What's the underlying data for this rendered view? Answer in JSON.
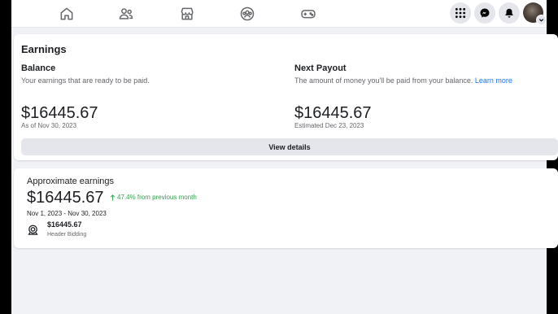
{
  "nav": {
    "icons": [
      "home-icon",
      "friends-icon",
      "marketplace-icon",
      "groups-icon",
      "gaming-icon"
    ],
    "actions": [
      "menu-grid-icon",
      "messenger-icon",
      "notifications-icon"
    ],
    "accent": "#1877f2"
  },
  "earnings": {
    "title": "Earnings",
    "balance": {
      "heading": "Balance",
      "description": "Your earnings that are ready to be paid.",
      "amount": "$16445.67",
      "date": "As of Nov 30, 2023"
    },
    "payout": {
      "heading": "Next Payout",
      "description": "The amount of money you'll be paid from your balance.",
      "learn_more": "Learn more",
      "amount": "$16445.67",
      "date": "Estimated Dec 23, 2023"
    },
    "view_details_label": "View details"
  },
  "approximate": {
    "title": "Approximate earnings",
    "amount": "$16445.67",
    "growth": "47.4% from previous month",
    "growth_color": "#31a24c",
    "date_range": "Nov 1, 2023 - Nov 30, 2023",
    "sources": [
      {
        "amount": "$16445.67",
        "label": "Header Bidding",
        "icon": "header-bidding-icon"
      }
    ]
  }
}
